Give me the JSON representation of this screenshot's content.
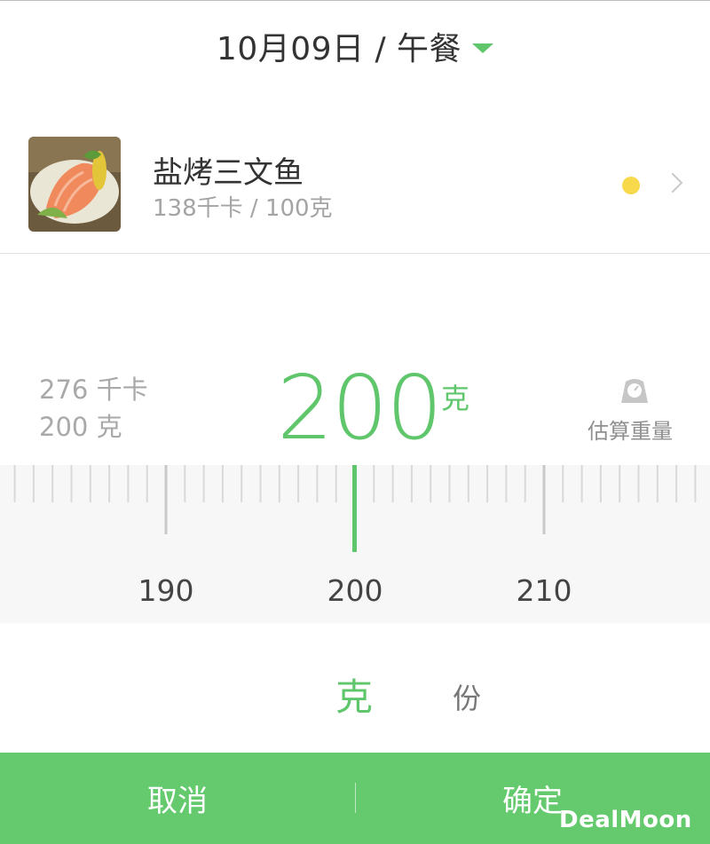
{
  "header": {
    "title": "10月09日 / 午餐"
  },
  "food": {
    "name": "盐烤三文鱼",
    "calories_per_100g": "138千卡 / 100克",
    "status_color": "#f8d94c"
  },
  "summary": {
    "calories": "276 千卡",
    "weight": "200 克"
  },
  "value": {
    "number": "200",
    "unit": "克"
  },
  "estimate": {
    "label": "估算重量",
    "icon": "scale-icon"
  },
  "ruler": {
    "labels": [
      "190",
      "200",
      "210"
    ],
    "current": 200,
    "accent": "#5fc66b"
  },
  "units": {
    "gram": "克",
    "portion": "份",
    "selected": "gram"
  },
  "bottom": {
    "cancel": "取消",
    "confirm": "确定"
  },
  "watermark": "DealMoon",
  "colors": {
    "accent": "#5fc66b",
    "bottom_bar": "#65ca6d"
  }
}
